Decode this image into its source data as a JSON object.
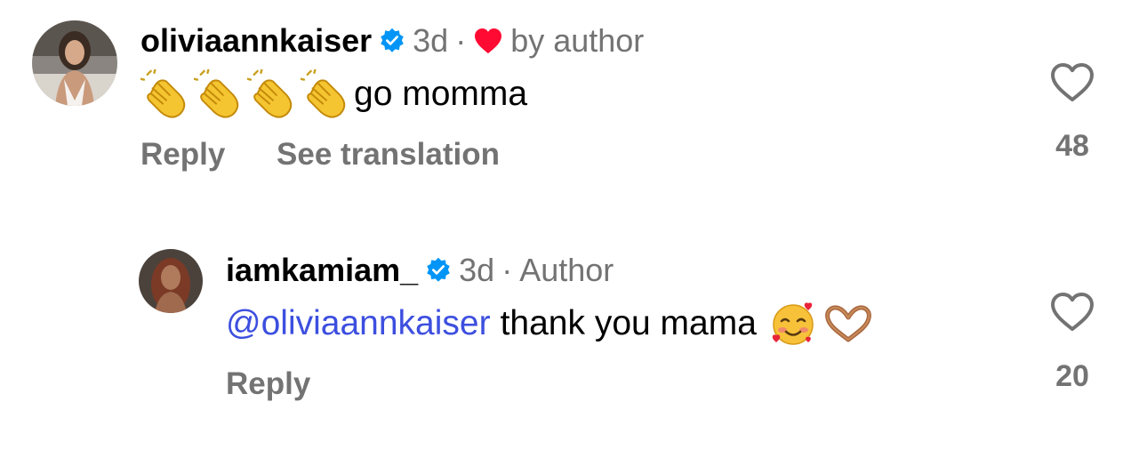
{
  "comments": [
    {
      "username": "oliviaannkaiser",
      "verified": true,
      "time": "3d",
      "author_like_label": "by author",
      "text": "go momma",
      "emoji": "clapping-hands x4",
      "actions": [
        "Reply",
        "See translation"
      ],
      "likes": "48"
    },
    {
      "username": "iamkamiam_",
      "verified": true,
      "time": "3d",
      "role_label": "Author",
      "mention": "@oliviaannkaiser",
      "text": "thank you mama",
      "emoji": "smiling-face-with-hearts, heart-hands",
      "actions": [
        "Reply"
      ],
      "likes": "20"
    }
  ],
  "colors": {
    "secondary_text": "#737373",
    "mention": "#3d4fdf",
    "verified_badge": "#0095f6",
    "author_like_heart": "#ff0a33"
  }
}
